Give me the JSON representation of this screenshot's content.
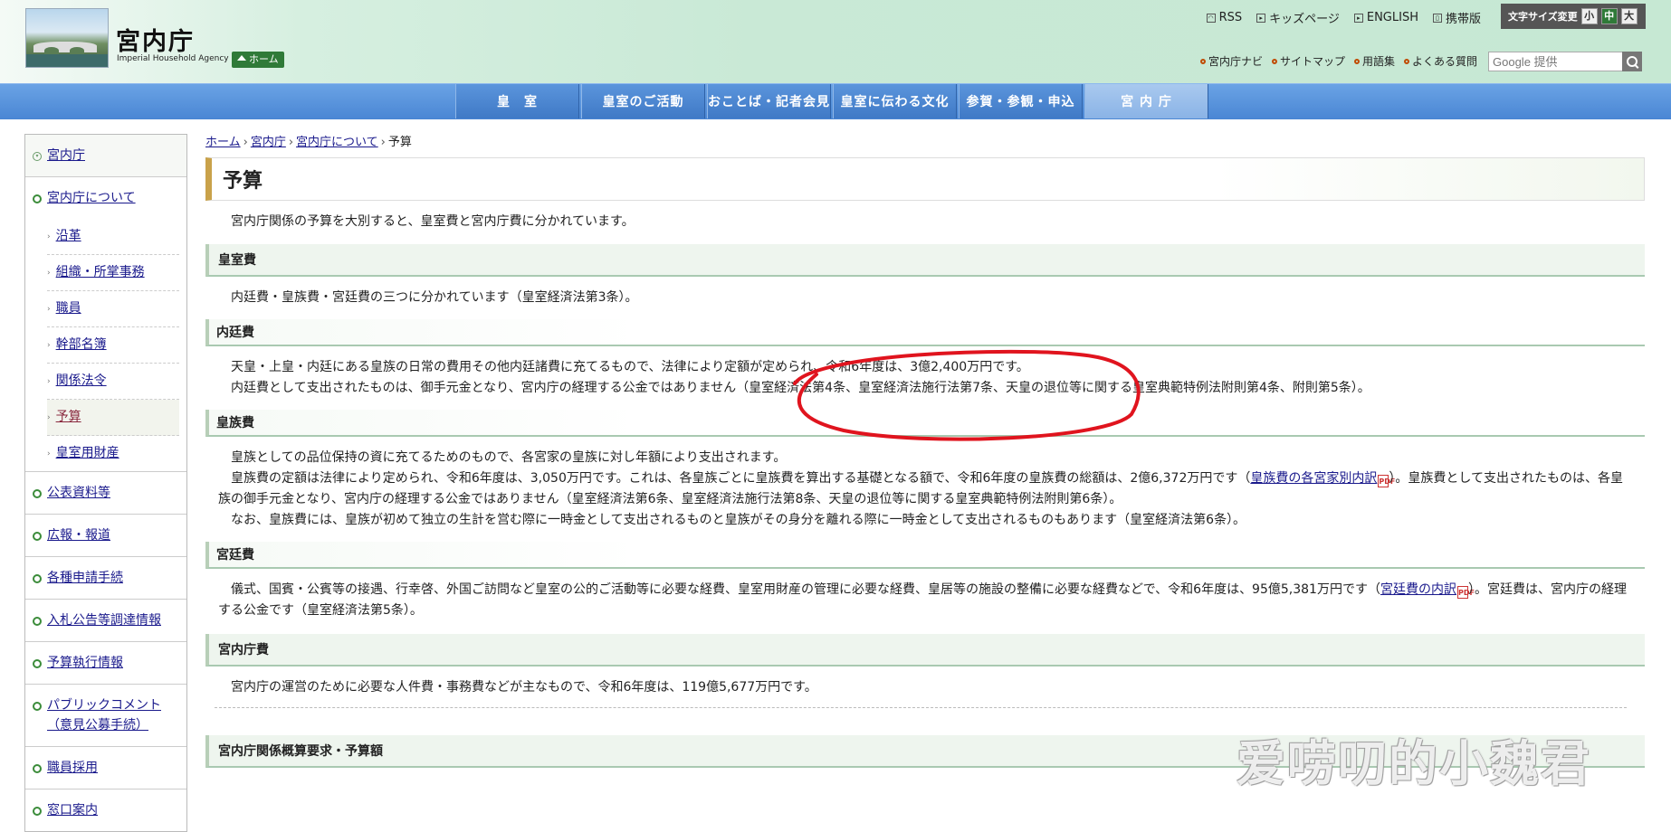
{
  "header": {
    "site_title_ja": "宮内庁",
    "site_title_en": "Imperial Household Agency",
    "home_label": "ホーム",
    "top_links": [
      "RSS",
      "キッズページ",
      "ENGLISH",
      "携帯版"
    ],
    "font_size_label": "文字サイズ変更",
    "font_sizes": [
      "小",
      "中",
      "大"
    ],
    "sub_links": [
      "宮内庁ナビ",
      "サイトマップ",
      "用語集",
      "よくある質問"
    ],
    "search_placeholder": "Google 提供"
  },
  "gnav": {
    "items": [
      "皇　室",
      "皇室のご活動",
      "おことば・記者会見",
      "皇室に伝わる文化",
      "参賀・参観・申込",
      "宮 内 庁"
    ],
    "active_index": 5
  },
  "sidebar": {
    "top": "宮内庁",
    "parent": "宮内庁について",
    "sub_items": [
      "沿革",
      "組織・所掌事務",
      "職員",
      "幹部名簿",
      "関係法令",
      "予算",
      "皇室用財産"
    ],
    "selected_sub": "予算",
    "items": [
      "公表資料等",
      "広報・報道",
      "各種申請手続",
      "入札公告等調達情報",
      "予算執行情報",
      "パブリックコメント（意見公募手続）",
      "職員採用",
      "窓口案内"
    ]
  },
  "breadcrumb": [
    "ホーム",
    "宮内庁",
    "宮内庁について",
    "予算"
  ],
  "page_title": "予算",
  "intro": "宮内庁関係の予算を大別すると、皇室費と宮内庁費に分かれています。",
  "koushitsuhi": {
    "heading": "皇室費",
    "text": "内廷費・皇族費・宮廷費の三つに分かれています（皇室経済法第3条）。"
  },
  "naiteihi": {
    "heading": "内廷費",
    "line1": "天皇・上皇・内廷にある皇族の日常の費用その他内廷諸費に充てるもので、法律により定額が定められ、令和6年度は、3億2,400万円です。",
    "line2": "内廷費として支出されたものは、御手元金となり、宮内庁の経理する公金ではありません（皇室経済法第4条、皇室経済法施行法第7条、天皇の退位等に関する皇室典範特例法附則第4条、附則第5条）。"
  },
  "kouzokuhi": {
    "heading": "皇族費",
    "line1": "皇族としての品位保持の資に充てるためのもので、各宮家の皇族に対し年額により支出されます。",
    "line2a": "皇族費の定額は法律により定められ、令和6年度は、3,050万円です。これは、各皇族ごとに皇族費を算出する基礎となる額で、令和6年度の皇族費の総額は、2億6,372万円です（",
    "line2_link": "皇族費の各宮家別内訳",
    "line2b": "）。皇族費として支出されたものは、各皇族の御手元金となり、宮内庁の経理する公金ではありません（皇室経済法第6条、皇室経済法施行法第8条、天皇の退位等に関する皇室典範特例法附則第6条）。",
    "line3": "なお、皇族費には、皇族が初めて独立の生計を営む際に一時金として支出されるものと皇族がその身分を離れる際に一時金として支出されるものもあります（皇室経済法第6条）。"
  },
  "kyuteihi": {
    "heading": "宮廷費",
    "line1a": "儀式、国賓・公賓等の接遇、行幸啓、外国ご訪問など皇室の公的ご活動等に必要な経費、皇室用財産の管理に必要な経費、皇居等の施設の整備に必要な経費などで、令和6年度は、95億5,381万円です（",
    "line1_link": "宮廷費の内訳",
    "line1b": "）。宮廷費は、宮内庁の経理する公金です（皇室経済法第5条）。"
  },
  "kunaichohi": {
    "heading": "宮内庁費",
    "text": "宮内庁の運営のために必要な人件費・事務費などが主なもので、令和6年度は、119億5,677万円です。"
  },
  "next_heading": "宮内庁関係概算要求・予算額",
  "pdf_icon_text": "PDF",
  "watermark": "爱唠叨的小魏君",
  "colors": {
    "nav_blue": "#4a86d4",
    "header_green": "#c9e9d6",
    "annotation_red": "#e0141e",
    "title_gold": "#c9a24a"
  }
}
